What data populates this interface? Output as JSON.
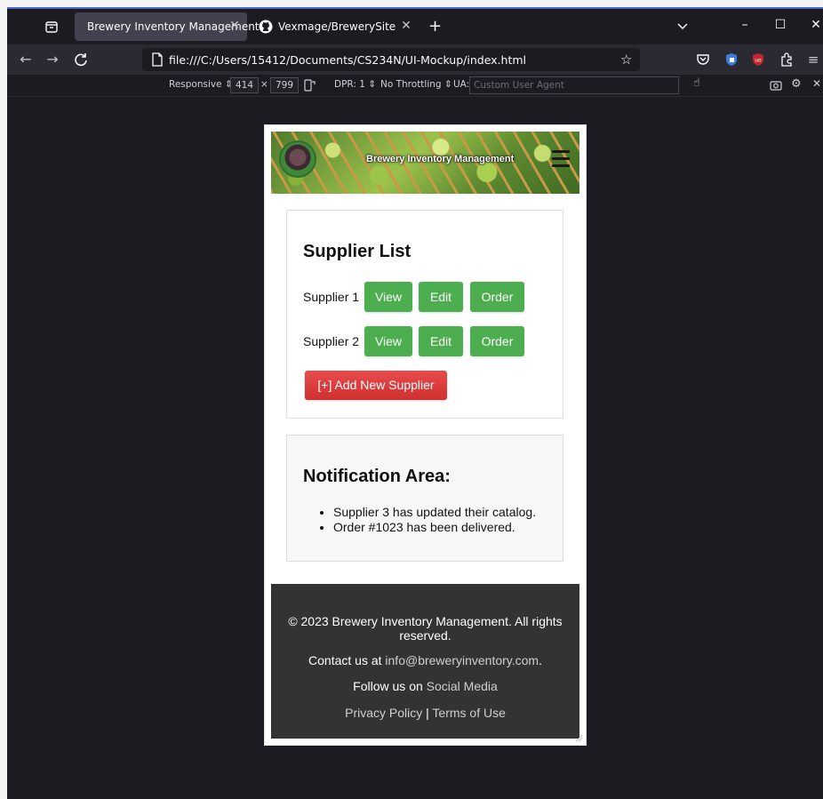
{
  "browser": {
    "tabs": [
      {
        "title": "Brewery Inventory Management",
        "active": true
      },
      {
        "title": "Vexmage/BrewerySite",
        "active": false
      }
    ],
    "url": "file:///C:/Users/15412/Documents/CS234N/UI-Mockup/index.html",
    "window_controls": {
      "minimize": "–",
      "maximize": "☐",
      "close": "✕"
    },
    "new_tab": "+",
    "close_tab": "✕"
  },
  "responsive_toolbar": {
    "mode": "Responsive",
    "width": "414",
    "times": "×",
    "height": "799",
    "dpr": "DPR: 1",
    "throttling": "No Throttling",
    "ua_label": "UA:",
    "ua_placeholder": "Custom User Agent"
  },
  "site": {
    "header_title": "Brewery Inventory Management",
    "suppliers": {
      "heading": "Supplier List",
      "rows": [
        {
          "name": "Supplier 1",
          "view": "View",
          "edit": "Edit",
          "order": "Order"
        },
        {
          "name": "Supplier 2",
          "view": "View",
          "edit": "Edit",
          "order": "Order"
        }
      ],
      "add_button": "[+] Add New Supplier"
    },
    "notifications": {
      "heading": "Notification Area:",
      "items": [
        "Supplier 3 has updated their catalog.",
        "Order #1023 has been delivered."
      ]
    },
    "footer": {
      "copyright": "© 2023 Brewery Inventory Management. All rights reserved.",
      "contact_prefix": "Contact us at ",
      "contact_email": "info@breweryinventory.com",
      "contact_suffix": ".",
      "follow_prefix": "Follow us on ",
      "follow_link": "Social Media",
      "privacy": "Privacy Policy",
      "separator": " | ",
      "terms": "Terms of Use"
    }
  },
  "colors": {
    "button_green": "#4cae4f",
    "button_red": "#d93636",
    "footer_bg": "#333333",
    "browser_bg": "#1c1b22"
  }
}
